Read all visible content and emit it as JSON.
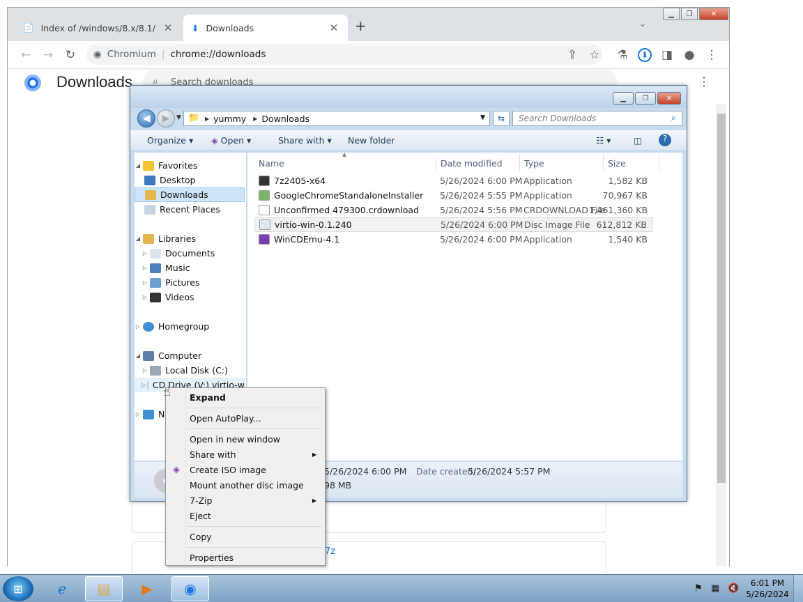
{
  "browser": {
    "tabs": [
      {
        "title": "Index of /windows/8.x/8.1/",
        "active": false
      },
      {
        "title": "Downloads",
        "active": true
      }
    ],
    "omnibox": {
      "site": "Chromium",
      "url": "chrome://downloads"
    }
  },
  "downloads_page": {
    "title": "Downloads",
    "search_placeholder": "Search downloads",
    "visible_fragment": "7z"
  },
  "explorer": {
    "breadcrumb": [
      "yummy",
      "Downloads"
    ],
    "search_placeholder": "Search Downloads",
    "commands": [
      "Organize",
      "Open",
      "Share with",
      "New folder"
    ],
    "nav": {
      "favorites_label": "Favorites",
      "favorites": [
        "Desktop",
        "Downloads",
        "Recent Places"
      ],
      "libraries_label": "Libraries",
      "libraries": [
        "Documents",
        "Music",
        "Pictures",
        "Videos"
      ],
      "homegroup": "Homegroup",
      "computer_label": "Computer",
      "computer": [
        "Local Disk (C:)",
        "CD Drive (V:) virtio-w"
      ],
      "network_initial": "N"
    },
    "columns": [
      "Name",
      "Date modified",
      "Type",
      "Size"
    ],
    "files": [
      {
        "name": "7z2405-x64",
        "date": "5/26/2024 6:00 PM",
        "type": "Application",
        "size": "1,582 KB"
      },
      {
        "name": "GoogleChromeStandaloneInstaller",
        "date": "5/26/2024 5:55 PM",
        "type": "Application",
        "size": "70,967 KB"
      },
      {
        "name": "Unconfirmed 479300.crdownload",
        "date": "5/26/2024 5:56 PM",
        "type": "CRDOWNLOAD File",
        "size": "1,461,360 KB"
      },
      {
        "name": "virtio-win-0.1.240",
        "date": "5/26/2024 6:00 PM",
        "type": "Disc Image File",
        "size": "612,812 KB"
      },
      {
        "name": "WinCDEmu-4.1",
        "date": "5/26/2024 6:00 PM",
        "type": "Application",
        "size": "1,540 KB"
      }
    ],
    "details": {
      "modified_value": "5/26/2024 6:00 PM",
      "size_value": "98 MB",
      "created_label": "Date created:",
      "created_value": "5/26/2024 5:57 PM"
    }
  },
  "context_menu": {
    "items": [
      "Expand",
      "Open AutoPlay...",
      "Open in new window",
      "Share with",
      "Create ISO image",
      "Mount another disc image",
      "7-Zip",
      "Eject",
      "Copy",
      "Properties"
    ]
  },
  "taskbar": {
    "time": "6:01 PM",
    "date": "5/26/2024"
  }
}
